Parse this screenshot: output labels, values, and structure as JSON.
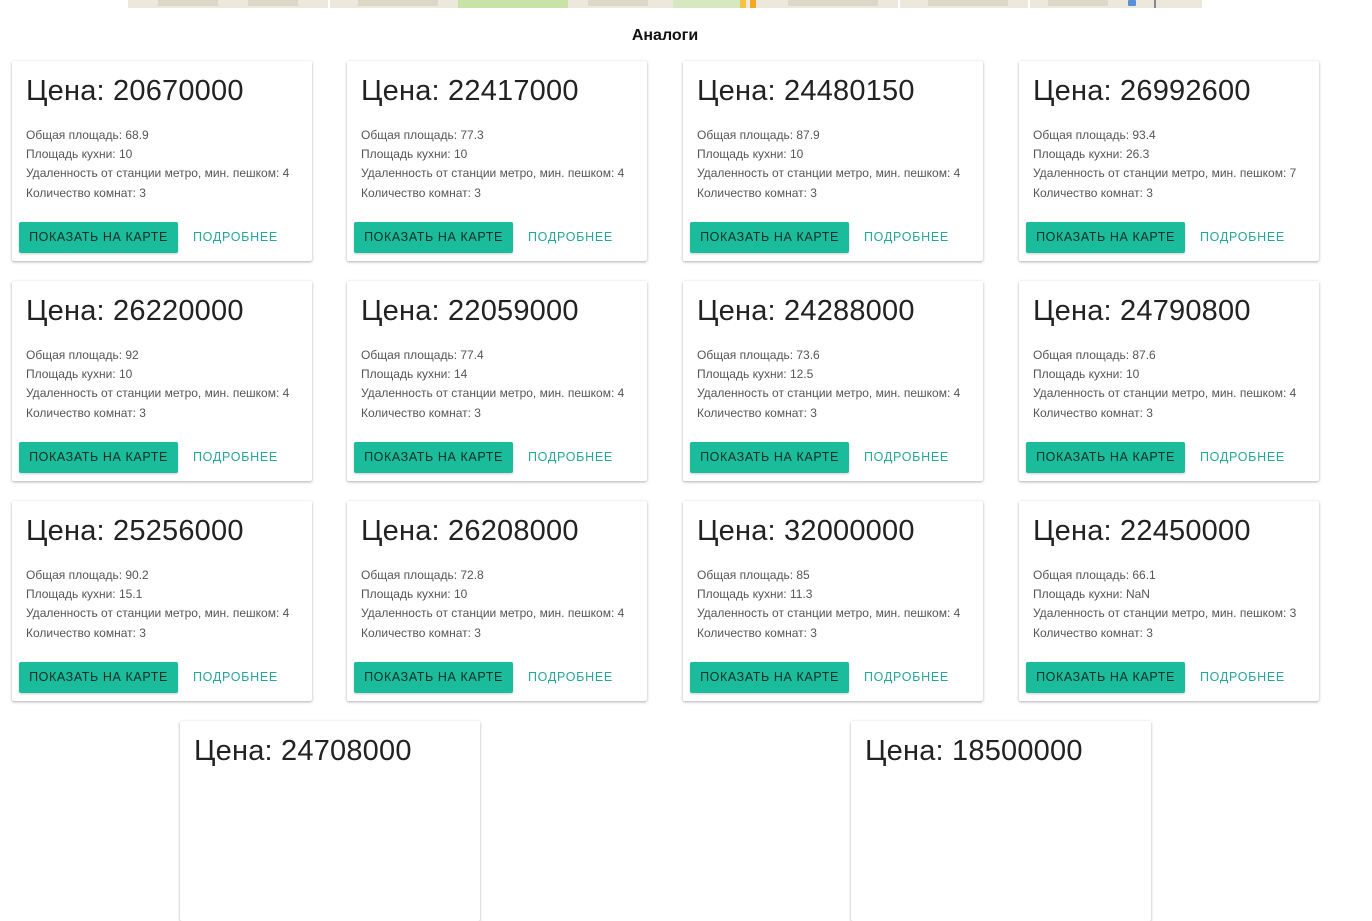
{
  "section_title": "Аналоги",
  "colors": {
    "accent": "#1abc9c",
    "link": "#26a69a",
    "background": "#ffffff"
  },
  "labels": {
    "show_on_map": "ПОКАЗАТЬ НА КАРТЕ",
    "more": "ПОДРОБНЕЕ"
  },
  "cards": [
    {
      "price": "Цена: 20670000",
      "area": "Общая площадь: 68.9",
      "kitchen": "Площадь кухни: 10",
      "metro": "Удаленность от станции метро, мин. пешком: 4",
      "rooms": "Количество комнат: 3"
    },
    {
      "price": "Цена: 22417000",
      "area": "Общая площадь: 77.3",
      "kitchen": "Площадь кухни: 10",
      "metro": "Удаленность от станции метро, мин. пешком: 4",
      "rooms": "Количество комнат: 3"
    },
    {
      "price": "Цена: 24480150",
      "area": "Общая площадь: 87.9",
      "kitchen": "Площадь кухни: 10",
      "metro": "Удаленность от станции метро, мин. пешком: 4",
      "rooms": "Количество комнат: 3"
    },
    {
      "price": "Цена: 26992600",
      "area": "Общая площадь: 93.4",
      "kitchen": "Площадь кухни: 26.3",
      "metro": "Удаленность от станции метро, мин. пешком: 7",
      "rooms": "Количество комнат: 3"
    },
    {
      "price": "Цена: 26220000",
      "area": "Общая площадь: 92",
      "kitchen": "Площадь кухни: 10",
      "metro": "Удаленность от станции метро, мин. пешком: 4",
      "rooms": "Количество комнат: 3"
    },
    {
      "price": "Цена: 22059000",
      "area": "Общая площадь: 77.4",
      "kitchen": "Площадь кухни: 14",
      "metro": "Удаленность от станции метро, мин. пешком: 4",
      "rooms": "Количество комнат: 3"
    },
    {
      "price": "Цена: 24288000",
      "area": "Общая площадь: 73.6",
      "kitchen": "Площадь кухни: 12.5",
      "metro": "Удаленность от станции метро, мин. пешком: 4",
      "rooms": "Количество комнат: 3"
    },
    {
      "price": "Цена: 24790800",
      "area": "Общая площадь: 87.6",
      "kitchen": "Площадь кухни: 10",
      "metro": "Удаленность от станции метро, мин. пешком: 4",
      "rooms": "Количество комнат: 3"
    },
    {
      "price": "Цена: 25256000",
      "area": "Общая площадь: 90.2",
      "kitchen": "Площадь кухни: 15.1",
      "metro": "Удаленность от станции метро, мин. пешком: 4",
      "rooms": "Количество комнат: 3"
    },
    {
      "price": "Цена: 26208000",
      "area": "Общая площадь: 72.8",
      "kitchen": "Площадь кухни: 10",
      "metro": "Удаленность от станции метро, мин. пешком: 4",
      "rooms": "Количество комнат: 3"
    },
    {
      "price": "Цена: 32000000",
      "area": "Общая площадь: 85",
      "kitchen": "Площадь кухни: 11.3",
      "metro": "Удаленность от станции метро, мин. пешком: 4",
      "rooms": "Количество комнат: 3"
    },
    {
      "price": "Цена: 22450000",
      "area": "Общая площадь: 66.1",
      "kitchen": "Площадь кухни: NaN",
      "metro": "Удаленность от станции метро, мин. пешком: 3",
      "rooms": "Количество комнат: 3"
    },
    {
      "price": "Цена: 24708000"
    },
    {
      "price": "Цена: 18500000"
    }
  ]
}
